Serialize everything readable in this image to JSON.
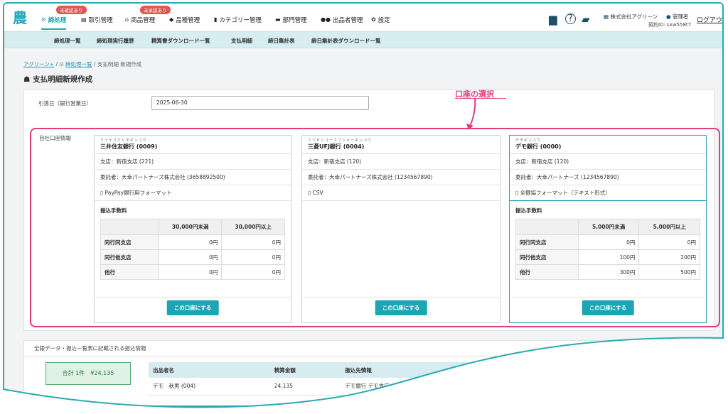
{
  "logo": "農",
  "nav": [
    {
      "label": "締処理",
      "badge": "未確認あり",
      "icon": "check-circle-icon"
    },
    {
      "label": "取引管理",
      "icon": "receipt-icon"
    },
    {
      "label": "商品管理",
      "badge": "未承認あり",
      "icon": "basket-icon"
    },
    {
      "label": "品種管理",
      "icon": "tag-icon"
    },
    {
      "label": "カテゴリー管理",
      "icon": "bookmark-icon"
    },
    {
      "label": "部門管理",
      "icon": "folder-icon"
    },
    {
      "label": "出品者管理",
      "icon": "users-icon"
    },
    {
      "label": "設定",
      "icon": "gear-icon"
    }
  ],
  "header": {
    "company": "株式会社アグリーン",
    "role": "管理者",
    "contract": "契約ID: sxw558t7",
    "logout": "ログアウト"
  },
  "subnav": [
    "締処理一覧",
    "締処理実行履歴",
    "精算書ダウンロード一覧",
    "支払明細",
    "締日集計表",
    "締日集計表ダウンロード一覧"
  ],
  "breadcrumb": {
    "root": "アグリーン+",
    "sep1": "/",
    "link": "締処理一覧",
    "sep2": "/",
    "current": "支払明細 新規作成"
  },
  "page_title": "支払明細新規作成",
  "withdraw": {
    "label": "引落日（銀行営業日）",
    "value": "2025-06-30"
  },
  "annotation": "口座の選択",
  "own_account_label": "自社口座情報",
  "fee_title": "振込手数料",
  "fee_rows": [
    "同行同支店",
    "同行他支店",
    "他行"
  ],
  "select_button": "この口座にする",
  "banks": [
    {
      "kana": "ミツイスミトモギンコウ",
      "name": "三井住友銀行 (0009)",
      "branch": "支店：新宿支店 (221)",
      "consignor": "委託者：大幸パートナーズ株式会社 (3658892500)",
      "format": "PayPay銀行用フォーマット",
      "fee_cols": [
        "30,000円未満",
        "30,000円以上"
      ],
      "fees": [
        [
          "0円",
          "0円"
        ],
        [
          "0円",
          "0円"
        ],
        [
          "0円",
          "0円"
        ]
      ]
    },
    {
      "kana": "ミツビシユーエフジェーギンコウ",
      "name": "三菱UFJ銀行 (0004)",
      "branch": "支店：新宿支店 (120)",
      "consignor": "委託者：大幸パートナーズ株式会社 (1234567890)",
      "format": "CSV"
    },
    {
      "kana": "デモギンコウ",
      "name": "デモ銀行 (0000)",
      "branch": "支店：新宿支店 (120)",
      "consignor": "委託者：大幸パートナーズ (1234567890)",
      "format": "全銀協フォーマット（テキスト形式）",
      "fee_cols": [
        "5,000円未満",
        "5,000円以上"
      ],
      "fees": [
        [
          "0円",
          "0円"
        ],
        [
          "100円",
          "200円"
        ],
        [
          "300円",
          "500円"
        ]
      ]
    }
  ],
  "transfer": {
    "title": "全銀データ・振込一覧表に記載される振込情報",
    "total": "合計 1件　¥24,135",
    "columns": [
      "出品者名",
      "精算金額",
      "振込先情報"
    ],
    "rows": [
      [
        "デモ　秋男 (004)",
        "24,135",
        "デモ銀行 デモ支店 デ"
      ]
    ]
  }
}
